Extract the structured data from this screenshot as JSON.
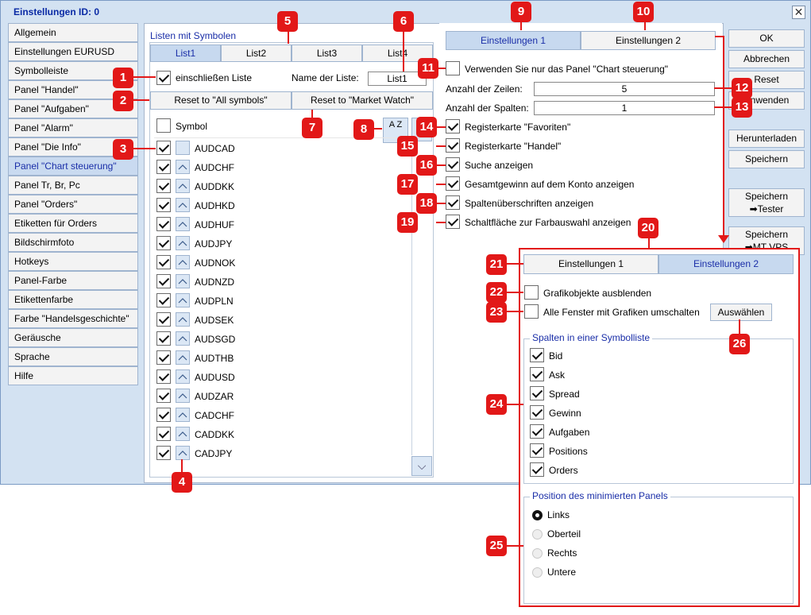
{
  "window": {
    "title": "Einstellungen   ID: 0",
    "close": "✕"
  },
  "sidebar": {
    "items": [
      {
        "label": "Allgemein"
      },
      {
        "label": "Einstellungen EURUSD"
      },
      {
        "label": "Symbolleiste"
      },
      {
        "label": "Panel \"Handel\""
      },
      {
        "label": "Panel \"Aufgaben\""
      },
      {
        "label": "Panel \"Alarm\""
      },
      {
        "label": "Panel \"Die Info\""
      },
      {
        "label": "Panel \"Chart steuerung\""
      },
      {
        "label": "Panel Tr, Br, Pc"
      },
      {
        "label": "Panel \"Orders\""
      },
      {
        "label": "Etiketten für Orders"
      },
      {
        "label": "Bildschirmfoto"
      },
      {
        "label": "Hotkeys"
      },
      {
        "label": "Panel-Farbe"
      },
      {
        "label": "Etikettenfarbe"
      },
      {
        "label": "Farbe \"Handelsgeschichte\""
      },
      {
        "label": "Geräusche"
      },
      {
        "label": "Sprache"
      },
      {
        "label": "Hilfe"
      }
    ],
    "active_index": 7
  },
  "lists": {
    "title": "Listen mit Symbolen",
    "tabs": [
      "List1",
      "List2",
      "List3",
      "List4"
    ],
    "include_label": "einschließen Liste",
    "name_label": "Name der Liste:",
    "name_value": "List1",
    "reset_all": "Reset to \"All symbols\"",
    "reset_mw": "Reset to \"Market Watch\"",
    "symbol_header": "Symbol",
    "sort_button": "A Z",
    "symbols": [
      "AUDCAD",
      "AUDCHF",
      "AUDDKK",
      "AUDHKD",
      "AUDHUF",
      "AUDJPY",
      "AUDNOK",
      "AUDNZD",
      "AUDPLN",
      "AUDSEK",
      "AUDSGD",
      "AUDTHB",
      "AUDUSD",
      "AUDZAR",
      "CADCHF",
      "CADDKK",
      "CADJPY"
    ],
    "scroll_down": "⌵"
  },
  "settings1": {
    "tabs": [
      "Einstellungen 1",
      "Einstellungen 2"
    ],
    "use_panel_only": "Verwenden Sie nur das Panel \"Chart steuerung\"",
    "rows_label": "Anzahl der Zeilen:",
    "rows_value": "5",
    "cols_label": "Anzahl der Spalten:",
    "cols_value": "1",
    "options": [
      "Registerkarte \"Favoriten\"",
      "Registerkarte \"Handel\"",
      "Suche anzeigen",
      "Gesamtgewinn auf dem Konto anzeigen",
      "Spaltenüberschriften anzeigen",
      "Schaltfläche zur Farbauswahl anzeigen"
    ]
  },
  "buttons": {
    "ok": "OK",
    "cancel": "Abbrechen",
    "reset": "Reset",
    "apply": "Anwenden",
    "download": "Herunterladen",
    "save": "Speichern",
    "save_tester_1": "Speichern",
    "save_tester_2": "➡Tester",
    "save_vps_1": "Speichern",
    "save_vps_2": "➡MT VPS"
  },
  "settings2": {
    "tabs": [
      "Einstellungen 1",
      "Einstellungen 2"
    ],
    "hide_objects": "Grafikobjekte ausblenden",
    "switch_all": "Alle Fenster mit Grafiken umschalten",
    "choose": "Auswählen",
    "columns_title": "Spalten in einer Symbolliste",
    "columns": [
      "Bid",
      "Ask",
      "Spread",
      "Gewinn",
      "Aufgaben",
      "Positions",
      "Orders"
    ],
    "position_title": "Position des minimierten Panels",
    "positions": [
      "Links",
      "Oberteil",
      "Rechts",
      "Untere"
    ],
    "position_selected": 0
  },
  "badges": [
    "1",
    "2",
    "3",
    "4",
    "5",
    "6",
    "7",
    "8",
    "9",
    "10",
    "11",
    "12",
    "13",
    "14",
    "15",
    "16",
    "17",
    "18",
    "19",
    "20",
    "21",
    "22",
    "23",
    "24",
    "25",
    "26"
  ],
  "accent_color": "#e21818",
  "active_color": "#1a2ea8"
}
